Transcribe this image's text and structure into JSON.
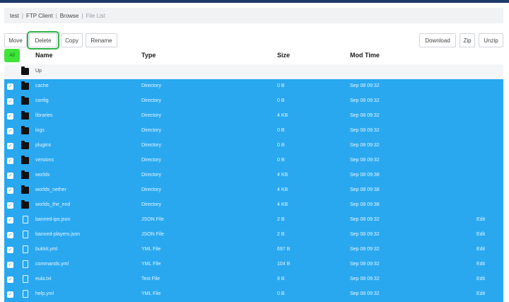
{
  "breadcrumb": [
    "test",
    "FTP Client",
    "Browse",
    "File List"
  ],
  "toolbar": {
    "move": "Move",
    "delete": "Delete",
    "copy": "Copy",
    "rename": "Rename",
    "download": "Download",
    "zip": "Zip",
    "unzip": "Unzip"
  },
  "select_all": "All",
  "columns": {
    "name": "Name",
    "type": "Type",
    "size": "Size",
    "modtime": "Mod Time"
  },
  "up_label": "Up",
  "rows": [
    {
      "name": "cache",
      "type": "Directory",
      "size": "0 B",
      "modtime": "Sep 08 09:32",
      "kind": "folder",
      "edit": ""
    },
    {
      "name": "config",
      "type": "Directory",
      "size": "0 B",
      "modtime": "Sep 08 09:32",
      "kind": "folder",
      "edit": ""
    },
    {
      "name": "libraries",
      "type": "Directory",
      "size": "4 KB",
      "modtime": "Sep 08 09:32",
      "kind": "folder",
      "edit": ""
    },
    {
      "name": "logs",
      "type": "Directory",
      "size": "0 B",
      "modtime": "Sep 08 09:32",
      "kind": "folder",
      "edit": ""
    },
    {
      "name": "plugins",
      "type": "Directory",
      "size": "0 B",
      "modtime": "Sep 08 09:32",
      "kind": "folder",
      "edit": ""
    },
    {
      "name": "versions",
      "type": "Directory",
      "size": "0 B",
      "modtime": "Sep 08 09:32",
      "kind": "folder",
      "edit": ""
    },
    {
      "name": "worlds",
      "type": "Directory",
      "size": "4 KB",
      "modtime": "Sep 08 09:38",
      "kind": "folder",
      "edit": ""
    },
    {
      "name": "worlds_nether",
      "type": "Directory",
      "size": "4 KB",
      "modtime": "Sep 08 09:38",
      "kind": "folder",
      "edit": ""
    },
    {
      "name": "worlds_the_end",
      "type": "Directory",
      "size": "4 KB",
      "modtime": "Sep 08 09:38",
      "kind": "folder",
      "edit": ""
    },
    {
      "name": "banned-ips.json",
      "type": "JSON File",
      "size": "2 B",
      "modtime": "Sep 08 09:32",
      "kind": "file",
      "edit": "Edit"
    },
    {
      "name": "banned-players.json",
      "type": "JSON File",
      "size": "2 B",
      "modtime": "Sep 08 09:32",
      "kind": "file",
      "edit": "Edit"
    },
    {
      "name": "bukkit.yml",
      "type": "YML File",
      "size": "697 B",
      "modtime": "Sep 08 09:32",
      "kind": "file",
      "edit": "Edit"
    },
    {
      "name": "commands.yml",
      "type": "YML File",
      "size": "104 B",
      "modtime": "Sep 08 09:32",
      "kind": "file",
      "edit": "Edit"
    },
    {
      "name": "eula.txt",
      "type": "Text File",
      "size": "9 B",
      "modtime": "Sep 08 09:32",
      "kind": "file",
      "edit": "Edit"
    },
    {
      "name": "help.yml",
      "type": "YML File",
      "size": "0 B",
      "modtime": "Sep 08 09:32",
      "kind": "file",
      "edit": "Edit"
    }
  ],
  "colors": {
    "selected_row": "#29a8f0",
    "highlight": "#2db34a",
    "topbar": "#1d3a6b"
  }
}
